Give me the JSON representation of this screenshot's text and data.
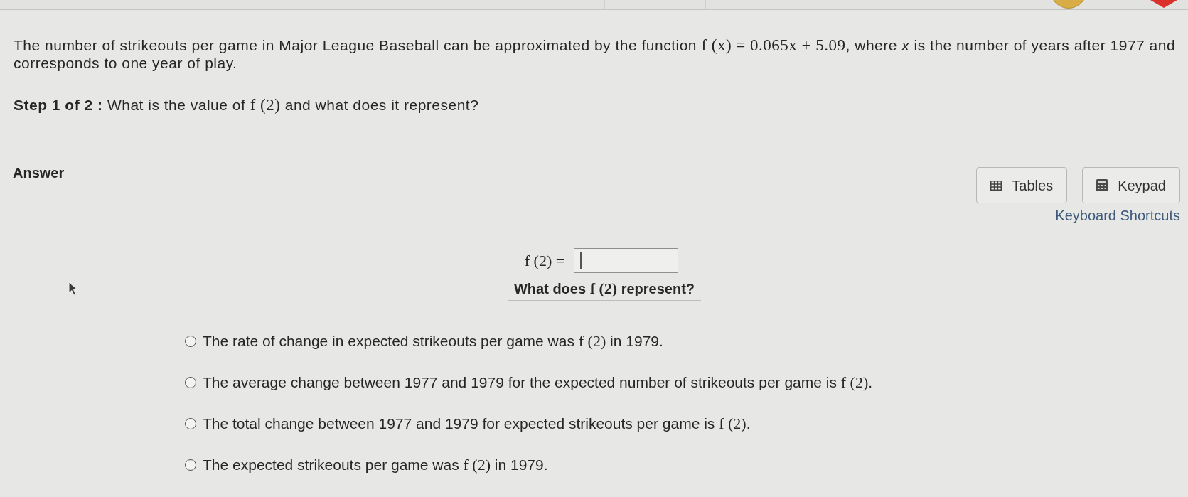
{
  "problem": {
    "parts": [
      {
        "kind": "text",
        "text": "The number of strikeouts per game in Major League Baseball can be approximated by the function "
      },
      {
        "kind": "math",
        "text": "f (x) = 0.065x + 5.09"
      },
      {
        "kind": "text",
        "text": ", where *x* is the number of years after 1977 and corresponds to one year of play."
      }
    ]
  },
  "step": {
    "label": "Step 1 of 2 :",
    "parts": [
      {
        "kind": "text",
        "text": "What is the value of "
      },
      {
        "kind": "math",
        "text": "f (2)"
      },
      {
        "kind": "text",
        "text": " and what does it represent?"
      }
    ]
  },
  "answer": {
    "heading": "Answer",
    "tools": [
      {
        "kind": "tables",
        "label": "Tables"
      },
      {
        "kind": "keypad",
        "label": "Keypad"
      }
    ],
    "shortcuts_link": "Keyboard Shortcuts",
    "equation_label": "f (2) =",
    "question": {
      "parts": [
        {
          "kind": "text",
          "text": "What does "
        },
        {
          "kind": "math",
          "text": "f (2)"
        },
        {
          "kind": "text",
          "text": " represent?"
        }
      ]
    },
    "options": [
      {
        "selected": false,
        "parts": [
          {
            "kind": "text",
            "text": "The rate of change in expected strikeouts per game was "
          },
          {
            "kind": "math",
            "text": "f (2)"
          },
          {
            "kind": "text",
            "text": " in 1979."
          }
        ]
      },
      {
        "selected": false,
        "parts": [
          {
            "kind": "text",
            "text": "The average change between 1977 and 1979 for the expected number of strikeouts per game is "
          },
          {
            "kind": "math",
            "text": "f (2)"
          },
          {
            "kind": "text",
            "text": "."
          }
        ]
      },
      {
        "selected": false,
        "parts": [
          {
            "kind": "text",
            "text": "The total change between 1977 and 1979 for expected strikeouts per game is "
          },
          {
            "kind": "math",
            "text": "f (2)"
          },
          {
            "kind": "text",
            "text": "."
          }
        ]
      },
      {
        "selected": false,
        "parts": [
          {
            "kind": "text",
            "text": "The expected strikeouts per game was "
          },
          {
            "kind": "math",
            "text": "f (2)"
          },
          {
            "kind": "text",
            "text": " in 1979."
          }
        ]
      }
    ]
  }
}
